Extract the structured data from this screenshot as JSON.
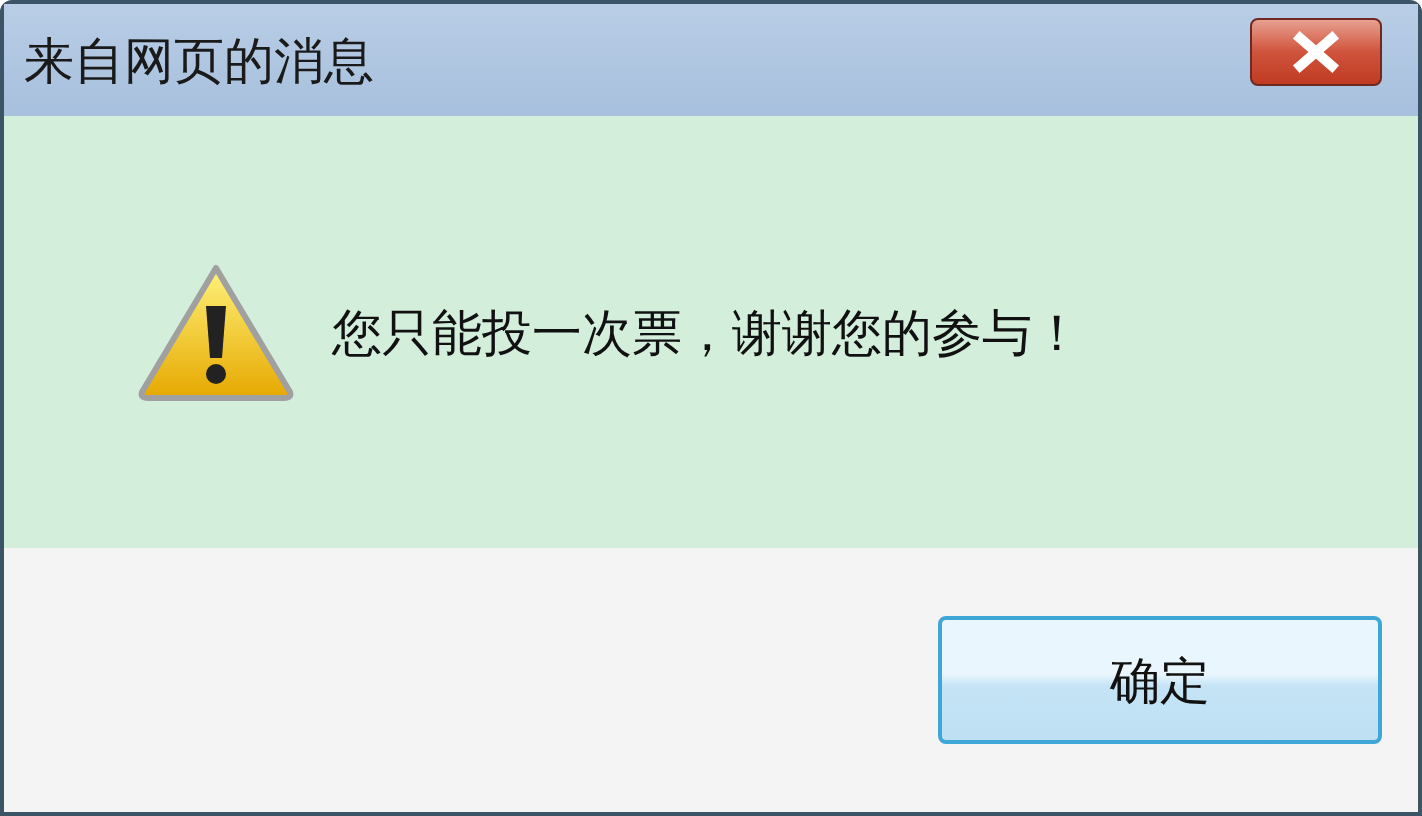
{
  "window": {
    "title": "来自网页的消息"
  },
  "message": {
    "text": "您只能投一次票，谢谢您的参与！"
  },
  "buttons": [
    {
      "label": "确定",
      "selected": true
    }
  ]
}
